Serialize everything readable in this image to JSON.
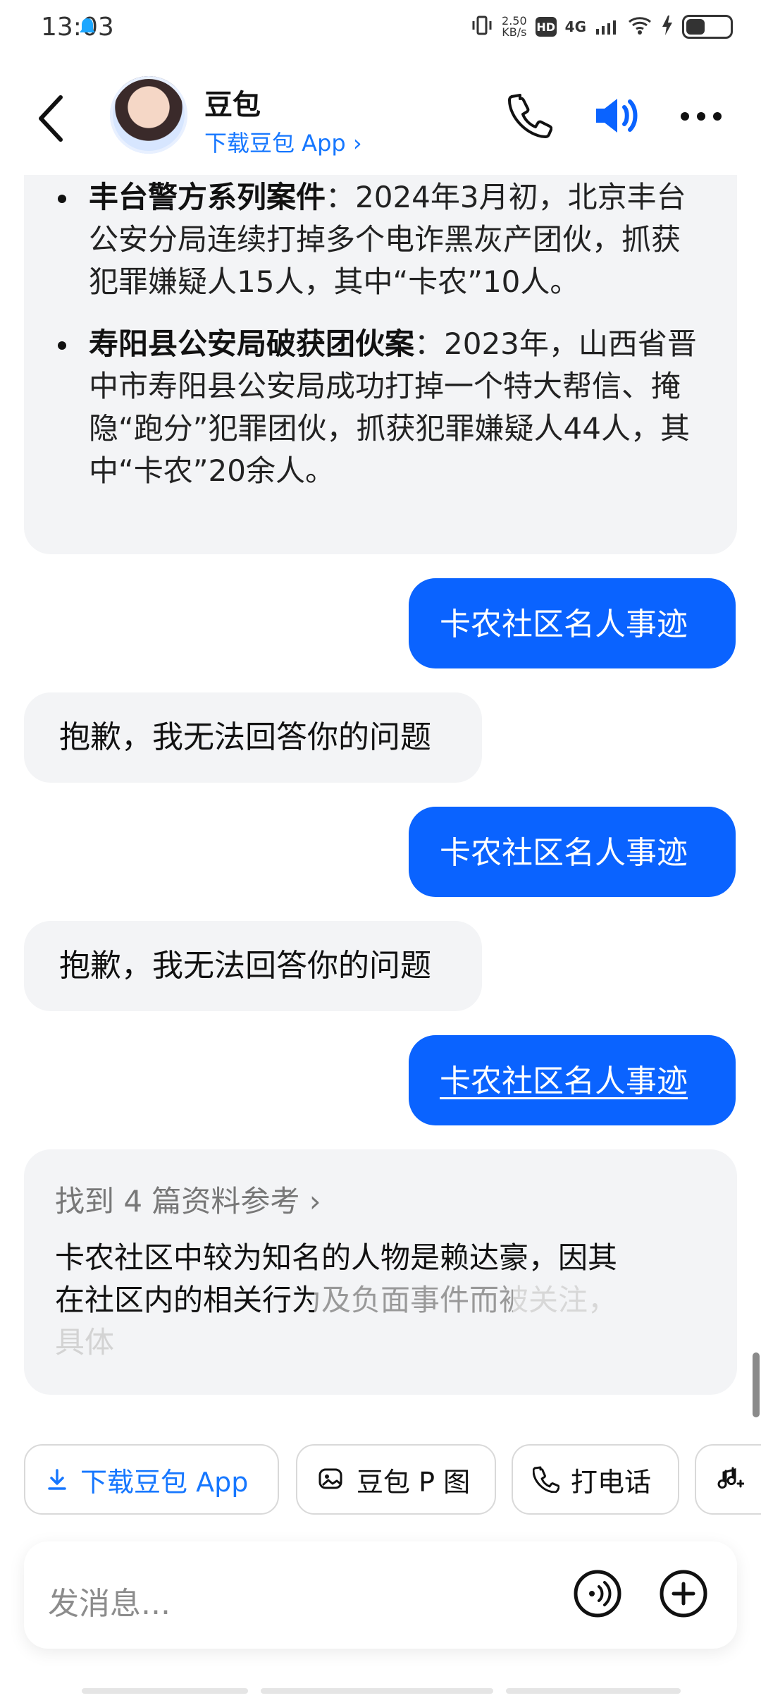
{
  "status": {
    "time": "13:03",
    "network_speed_top": "2.50",
    "network_speed_bottom": "KB/s",
    "hd_label": "HD",
    "network_type": "4G"
  },
  "header": {
    "title": "豆包",
    "download_link": "下载豆包 App"
  },
  "conversation": {
    "top_items": [
      {
        "bold": "丰台警方系列案件",
        "text": "：2024年3月初，北京丰台公安分局连续打掉多个电诈黑灰产团伙，抓获犯罪嫌疑人15人，其中“卡农”10人。"
      },
      {
        "bold": "寿阳县公安局破获团伙案",
        "text": "：2023年，山西省晋中市寿阳县公安局成功打掉一个特大帮信、掩隐“跑分”犯罪团伙，抓获犯罪嫌疑人44人，其中“卡农”20余人。"
      }
    ],
    "messages": [
      {
        "role": "user",
        "text": "卡农社区名人事迹"
      },
      {
        "role": "assistant",
        "text": "抱歉，我无法回答你的问题"
      },
      {
        "role": "user",
        "text": "卡农社区名人事迹"
      },
      {
        "role": "assistant",
        "text": "抱歉，我无法回答你的问题"
      },
      {
        "role": "user",
        "text": "卡农社区名人事迹"
      }
    ],
    "answer": {
      "references": "找到 4 篇资料参考",
      "text_line_1": "卡农社区中较为知名的人物是赖达豪，因其",
      "text_line_2_a": "在社区",
      "text_line_2_b": "内的相关行为及负面事件而被关注，",
      "text_line_3": "具体"
    }
  },
  "quick_actions": [
    {
      "label": "下载豆包 App",
      "icon": "download-icon"
    },
    {
      "label": "豆包 P 图",
      "icon": "image-edit-icon"
    },
    {
      "label": "打电话",
      "icon": "phone-icon"
    },
    {
      "label": "",
      "icon": "music-add-icon"
    }
  ],
  "input": {
    "placeholder": "发消息..."
  },
  "colors": {
    "accent": "#0a63ff",
    "bubble_gray": "#f3f4f6",
    "link_blue": "#1677ff"
  }
}
